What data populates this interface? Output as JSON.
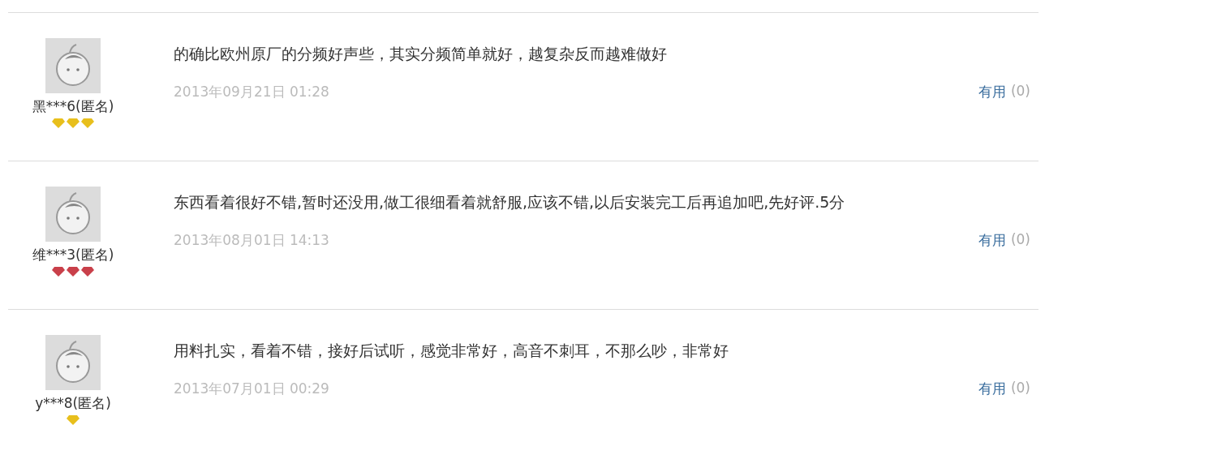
{
  "reviews": [
    {
      "user": "黑***6(匿名)",
      "badges": [
        {
          "color": "#e8bf1c"
        },
        {
          "color": "#e8bf1c"
        },
        {
          "color": "#e8bf1c"
        }
      ],
      "text": "的确比欧州原厂的分频好声些，其实分频简单就好，越复杂反而越难做好",
      "date": "2013年09月21日 01:28",
      "useful": "有用",
      "useful_count": "(0)"
    },
    {
      "user": "维***3(匿名)",
      "badges": [
        {
          "color": "#c9404a"
        },
        {
          "color": "#c9404a"
        },
        {
          "color": "#c9404a"
        }
      ],
      "text": "东西看着很好不错,暂时还没用,做工很细看着就舒服,应该不错,以后安装完工后再追加吧,先好评.5分",
      "date": "2013年08月01日 14:13",
      "useful": "有用",
      "useful_count": "(0)"
    },
    {
      "user": "y***8(匿名)",
      "badges": [
        {
          "color": "#e8bf1c"
        }
      ],
      "text": "用料扎实，看着不错，接好后试听，感觉非常好，高音不刺耳，不那么吵，非常好",
      "date": "2013年07月01日 00:29",
      "useful": "有用",
      "useful_count": "(0)"
    }
  ]
}
